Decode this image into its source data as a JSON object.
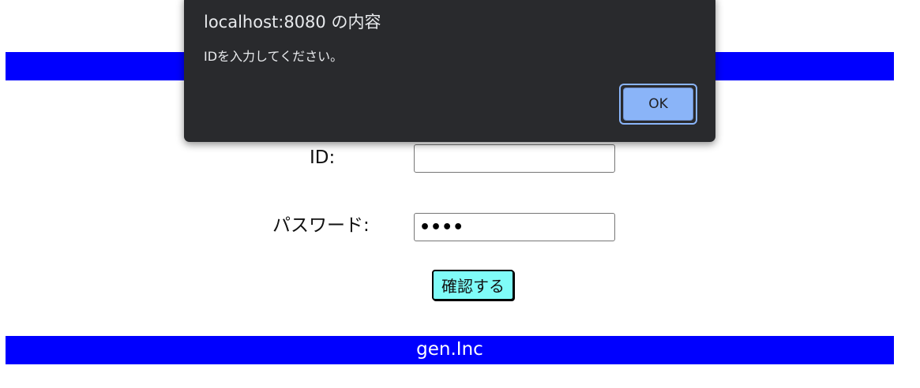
{
  "form": {
    "id_label": "ID:",
    "id_value": "",
    "password_label": "パスワード:",
    "password_value": "••••",
    "confirm_button": "確認する"
  },
  "footer": {
    "text": "gen.Inc"
  },
  "alert_dialog": {
    "title": "localhost:8080 の内容",
    "message": "IDを入力してください。",
    "ok_button": "OK"
  },
  "colors": {
    "bar": "#0000ff",
    "confirm_button_bg": "#7ffcf8",
    "dialog_bg": "#292a2d",
    "dialog_button": "#8ab4f8"
  }
}
